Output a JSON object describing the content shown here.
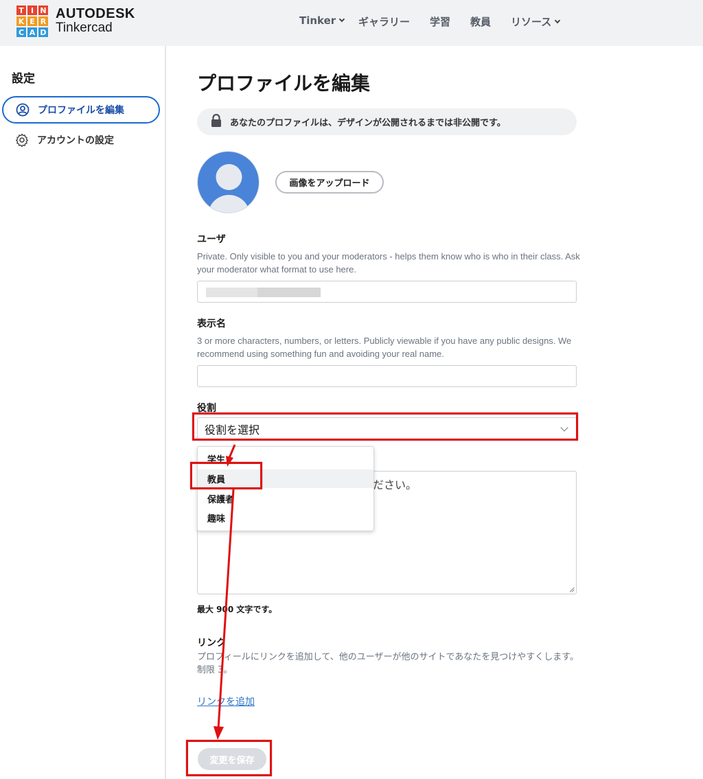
{
  "header": {
    "logo_letters": [
      "T",
      "I",
      "N",
      "K",
      "E",
      "R",
      "C",
      "A",
      "D"
    ],
    "logo_colors": [
      "#e8432f",
      "#e8432f",
      "#e8432f",
      "#f29b1d",
      "#f29b1d",
      "#f29b1d",
      "#2f9adb",
      "#2f9adb",
      "#2f9adb"
    ],
    "brand_top": "AUTODESK",
    "brand_bottom": "Tinkercad",
    "nav": [
      {
        "label": "Tinker",
        "dropdown": true
      },
      {
        "label": "ギャラリー",
        "dropdown": false
      },
      {
        "label": "学習",
        "dropdown": false
      },
      {
        "label": "教員",
        "dropdown": false
      },
      {
        "label": "リソース",
        "dropdown": true
      }
    ]
  },
  "sidebar": {
    "title": "設定",
    "items": [
      {
        "label": "プロファイルを編集",
        "icon": "user-circle-icon",
        "active": true
      },
      {
        "label": "アカウントの設定",
        "icon": "gear-icon",
        "active": false
      }
    ]
  },
  "main": {
    "title": "プロファイルを編集",
    "privacy_notice": "あなたのプロファイルは、デザインが公開されるまでは非公開です。",
    "upload_button": "画像をアップロード",
    "user": {
      "label": "ユーザ",
      "help": "Private. Only visible to you and your moderators - helps them know who is who in their class. Ask your moderator what format to use here."
    },
    "display_name": {
      "label": "表示名",
      "help": "3 or more characters, numbers, or letters. Publicly viewable if you have any public designs. We recommend using something fun and avoiding your real name.",
      "value": ""
    },
    "role": {
      "label": "役割",
      "selected": "役割を選択",
      "options": [
        "学生",
        "教員",
        "保護者",
        "趣味"
      ],
      "highlighted_option": "教員"
    },
    "bio": {
      "placeholder_visible": "ださい。",
      "max_chars": "最大 900 文字です。"
    },
    "links": {
      "label": "リンク",
      "help": "プロフィールにリンクを追加して、他のユーザーが他のサイトであなたを見つけやすくします。制限 3。",
      "add_link": "リンクを追加"
    },
    "save_button": "変更を保存"
  },
  "annotation": {
    "color": "#e01010"
  }
}
